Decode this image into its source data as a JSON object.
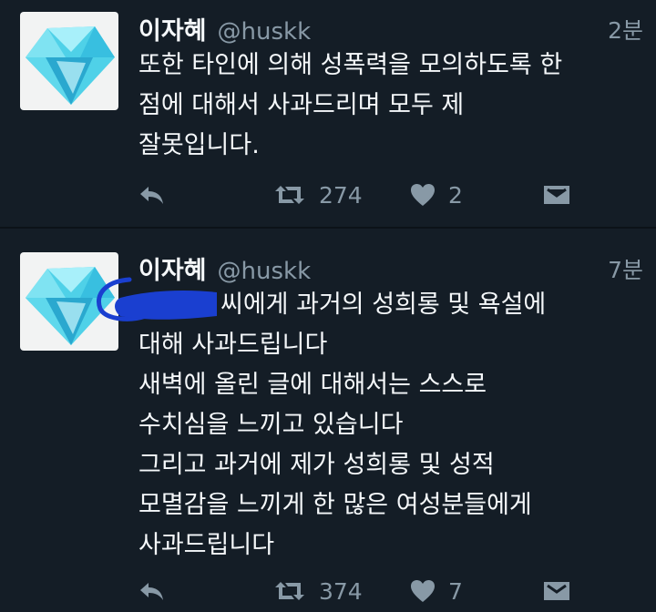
{
  "tweets": [
    {
      "name": "이자혜",
      "handle": "@huskk",
      "time": "2분",
      "lines": [
        "또한 타인에 의해 성폭력을 모의하도록 한",
        "점에 대해서 사과드리며 모두 제",
        "잘못입니다."
      ],
      "retweets": "274",
      "likes": "2"
    },
    {
      "name": "이자혜",
      "handle": "@huskk",
      "time": "7분",
      "lines": [
        "씨에게 과거의 성희롱 및 욕설에",
        "대해 사과드립니다",
        "새벽에 올린 글에 대해서는 스스로",
        "수치심을 느끼고 있습니다",
        "그리고 과거에 제가 성희롱 및 성적",
        "모멸감을 느끼게 한 많은 여성분들에게",
        "사과드립니다"
      ],
      "retweets": "374",
      "likes": "7"
    }
  ],
  "icons": {
    "avatar": "diamond-avatar",
    "reply": "reply-icon",
    "retweet": "retweet-icon",
    "like": "heart-icon",
    "dm": "direct-message-icon"
  },
  "colors": {
    "background": "#141d26",
    "text": "#f5f8fa",
    "muted": "#8899a6",
    "redaction_ink": "#1a3fd0"
  }
}
